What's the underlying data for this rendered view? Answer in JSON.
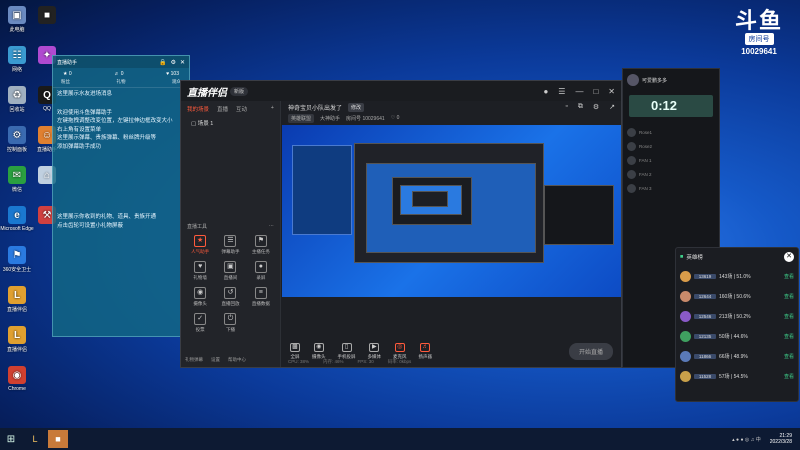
{
  "colors": {
    "accent": "#ff5a3c",
    "desktop": "#1559c8",
    "panel": "#126884",
    "success": "#3fd08a"
  },
  "watermark": {
    "logo": "斗鱼",
    "sub": "房间号",
    "room_id": "10029641"
  },
  "desktop_icons": [
    {
      "label": "此电脑",
      "icon": "computer-icon"
    },
    {
      "label": "网络",
      "icon": "network-icon"
    },
    {
      "label": "回收站",
      "icon": "recycle-bin-icon"
    },
    {
      "label": "控制面板",
      "icon": "control-panel-icon"
    },
    {
      "label": "微信",
      "icon": "wechat-icon"
    },
    {
      "label": "Microsoft Edge",
      "icon": "edge-icon"
    },
    {
      "label": "360安全卫士",
      "icon": "shield-icon"
    },
    {
      "label": "直播伴侣",
      "icon": "app-icon"
    },
    {
      "label": "直播伴侣",
      "icon": "app-icon"
    },
    {
      "label": "Chrome",
      "icon": "chrome-icon"
    }
  ],
  "desktop_icons2": [
    {
      "label": "",
      "icon": "app-icon"
    },
    {
      "label": "",
      "icon": "app-icon"
    },
    {
      "label": "QQ",
      "icon": "qq-icon"
    },
    {
      "label": "直播助手",
      "icon": "app-icon"
    },
    {
      "label": "",
      "icon": "app-icon"
    },
    {
      "label": "",
      "icon": "app-icon"
    }
  ],
  "assistant": {
    "title": "直播助手",
    "stats": [
      "0",
      "0",
      "103"
    ],
    "labels": [
      "粉丝",
      "礼物",
      "观众"
    ],
    "msg_intro": "这里展示水友进场消息",
    "msg_welcome": [
      "欢迎使用斗鱼弹幕助手",
      "左键拖拽调整改变位置，左键拉伸边框改变大小",
      "右上角有设置菜单",
      "这里展示弹幕、贵族弹幕、粉丝牌升级等",
      "添加弹幕助手成功"
    ],
    "msg_gift": [
      "这里展示你收到的礼物、道具、贵族开通",
      "点击齿轮可设置小礼物屏蔽"
    ]
  },
  "main": {
    "brand": "直播伴侣",
    "badge": "新版",
    "tabs": [
      "我的场景",
      "直播",
      "互动"
    ],
    "scene": "场景 1",
    "room_title": "神奇宝贝小队出发了",
    "edit": "修改",
    "category": "英雄联盟",
    "uploader": "大神助手",
    "room_label": "房间号",
    "room_id": "10029641",
    "likes": "0",
    "tools_header": "直播工具",
    "tools": [
      "人气助手",
      "弹幕助手",
      "主播任务",
      "礼物墙",
      "直播间",
      "录屏",
      "摄像头",
      "直播回放",
      "直播数据",
      "投票",
      "下播"
    ],
    "footer": [
      "礼物弹幕",
      "设置",
      "帮助中心"
    ],
    "controls": [
      "全屏",
      "摄像头",
      "手机投屏",
      "多媒体",
      "麦克风",
      "扬声器"
    ],
    "go_live": "开始直播",
    "status": [
      "CPU: 38%",
      "内存: 46%",
      "FPS: 30",
      "码率: 0kbps"
    ]
  },
  "room": {
    "name": "可爱鹏多多",
    "timer": "0:12",
    "chat": [
      "Rose1",
      "Rose2",
      "FAN 1",
      "FAN 2",
      "FAN 3"
    ]
  },
  "rank": {
    "title": "英雄榜",
    "rows": [
      {
        "id": "13619",
        "record": "143场 | 51.0%",
        "action": "查看",
        "color": "#d99c4a"
      },
      {
        "id": "12644",
        "record": "160场 | 50.6%",
        "action": "查看",
        "color": "#c88a6b"
      },
      {
        "id": "12546",
        "record": "213场 | 50.2%",
        "action": "查看",
        "color": "#8a5ac8"
      },
      {
        "id": "12135",
        "record": "50场 | 44.6%",
        "action": "查看",
        "color": "#3fa060"
      },
      {
        "id": "11866",
        "record": "66场 | 48.9%",
        "action": "查看",
        "color": "#5a7ab8"
      },
      {
        "id": "11528",
        "record": "57场 | 54.5%",
        "action": "查看",
        "color": "#c8a04a"
      }
    ]
  },
  "taskbar": {
    "time": "21:29",
    "date": "2022/3/28"
  }
}
